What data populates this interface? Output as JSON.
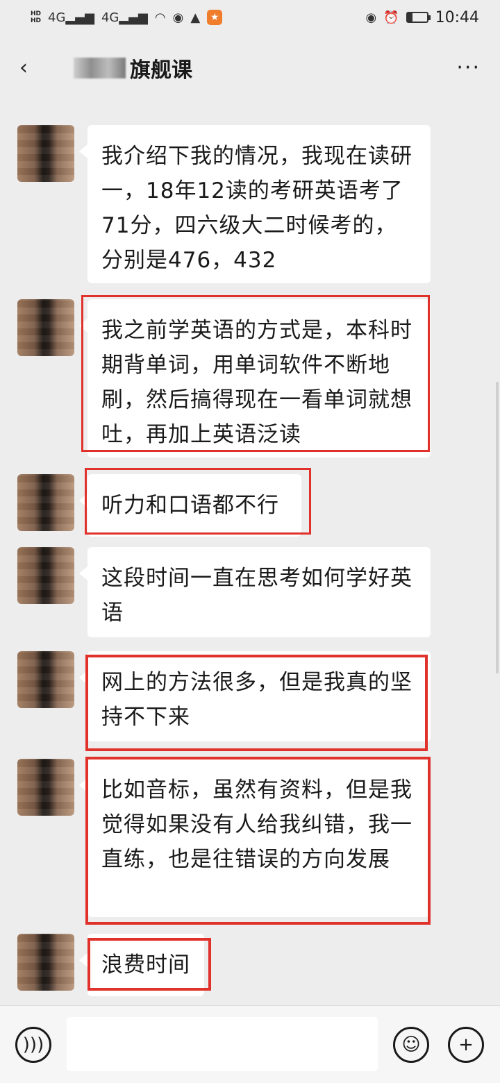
{
  "status_bar": {
    "network_1": "4G",
    "network_2": "4G",
    "time": "10:44",
    "battery_percent": 25
  },
  "header": {
    "back_icon": "back-arrow-icon",
    "title": "旗舰课",
    "more_label": "···"
  },
  "messages": [
    {
      "text": "我介绍下我的情况，我现在读研一，18年12读的考研英语考了71分，四六级大二时候考的，分别是476，432",
      "highlighted": false
    },
    {
      "text": "我之前学英语的方式是，本科时期背单词，用单词软件不断地刷，然后搞得现在一看单词就想吐，再加上英语泛读",
      "highlighted": true
    },
    {
      "text": "听力和口语都不行",
      "highlighted": true
    },
    {
      "text": "这段时间一直在思考如何学好英语",
      "highlighted": false
    },
    {
      "text": "网上的方法很多，但是我真的坚持不下来",
      "highlighted": true
    },
    {
      "text": "比如音标，虽然有资料，但是我觉得如果没有人给我纠错，我一直练，也是往错误的方向发展",
      "highlighted": true
    },
    {
      "text": "浪费时间",
      "highlighted": true
    }
  ],
  "input_bar": {
    "voice_icon": "voice-icon",
    "emoji_icon": "emoji-icon",
    "plus_icon": "plus-icon"
  },
  "colors": {
    "highlight": "#e0312b",
    "background": "#ededed",
    "bubble": "#ffffff"
  }
}
